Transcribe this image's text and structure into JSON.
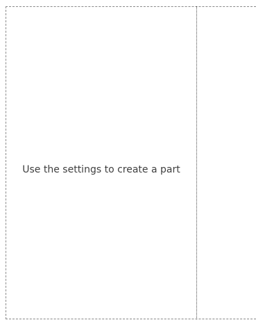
{
  "preview": {
    "placeholder": "Use the settings to create a part"
  }
}
